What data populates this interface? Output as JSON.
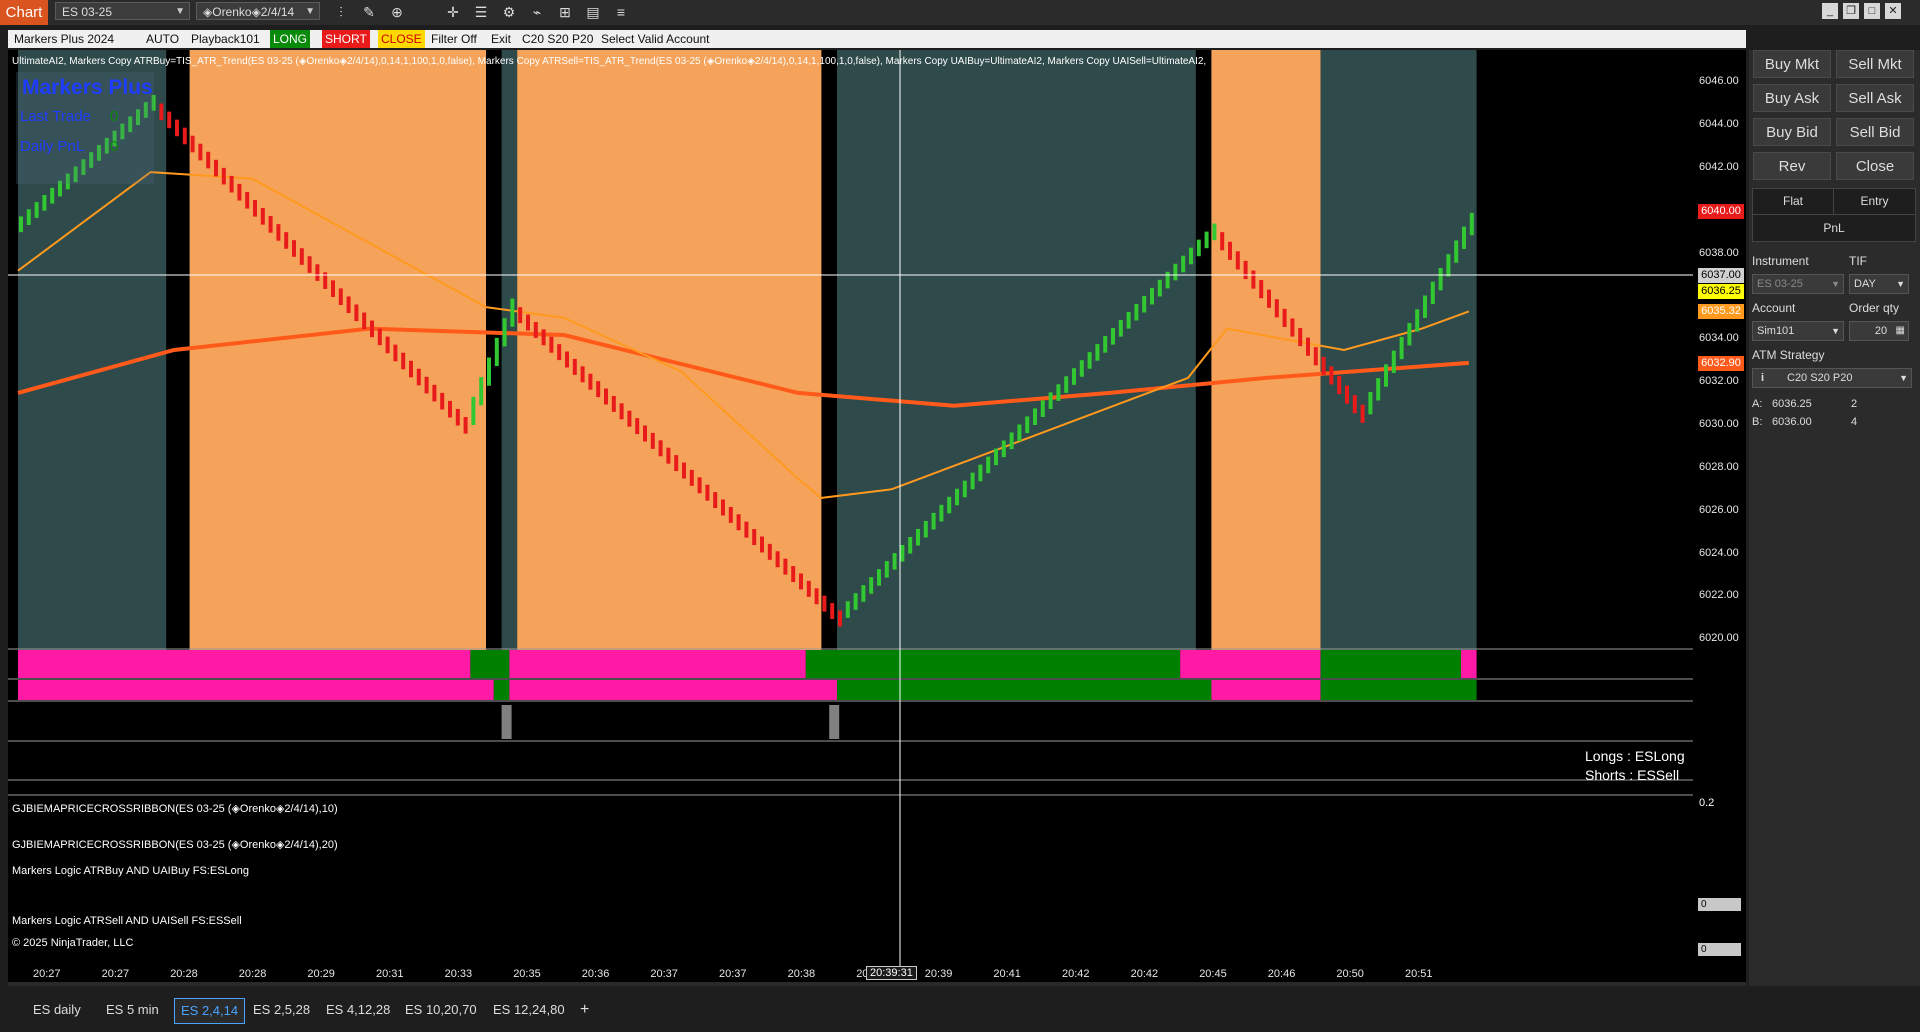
{
  "app": {
    "chart_tab": "Chart",
    "instrument_select": "ES 03-25",
    "bartype_select": "◈Orenko◈2/4/14"
  },
  "toolbar_icons": [
    "bars-icon",
    "pencil-icon",
    "zoom-in-icon",
    "crosshair-icon",
    "properties-icon",
    "strategies-icon",
    "indicators-icon",
    "chart-trader-icon",
    "data-box-icon",
    "menu-icon"
  ],
  "window_buttons": [
    "minimize-icon",
    "restore-icon",
    "maximize-icon",
    "close-icon"
  ],
  "strip": {
    "strategy": "Markers Plus 2024",
    "mode": "AUTO",
    "account": "Playback101",
    "long": "LONG",
    "short": "SHORT",
    "close": "CLOSE",
    "filter": "Filter Off",
    "exit": "Exit",
    "atm": "C20 S20 P20",
    "select": "Select Valid Account"
  },
  "chart": {
    "indicator_header": "UltimateAI2, Markers Copy ATRBuy=TIS_ATR_Trend(ES 03-25 (◈Orenko◈2/4/14),0,14,1,100,1,0,false), Markers Copy ATRSell=TIS_ATR_Trend(ES 03-25 (◈Orenko◈2/4/14),0,14,1,100,1,0,false), Markers Copy UAIBuy=UltimateAI2, Markers Copy UAISell=UltimateAI2,",
    "overlay_title": "Markers Plus",
    "last_trade_label": "Last Trade",
    "last_trade_value": "0",
    "daily_pnl_label": "Daily PnL",
    "daily_pnl_value": "0",
    "longs_text": "Longs : ESLong",
    "shorts_text": "Shorts : ESSell",
    "crosshair_price": "6037.00",
    "crosshair_time": "20:39:31",
    "price_labels": [
      {
        "text": "6040.00",
        "color": "#e81a1a"
      },
      {
        "text": "6037.00",
        "color": "#d0d0d0"
      },
      {
        "text": "6036.25",
        "color": "#ffff00"
      },
      {
        "text": "6035.32",
        "color": "#ff9a1e"
      },
      {
        "text": "6032.90",
        "color": "#ff5a1a"
      }
    ],
    "panels": {
      "ribbon1": "GJBIEMAPRICECROSSRIBBON(ES 03-25 (◈Orenko◈2/4/14),10)",
      "ribbon1_value": "0.2",
      "ribbon2": "GJBIEMAPRICECROSSRIBBON(ES 03-25 (◈Orenko◈2/4/14),20)",
      "logic_buy": "Markers Logic ATRBuy AND UAIBuy  FS:ESLong",
      "logic_buy_value": "0",
      "logic_sell": "Markers Logic ATRSell AND UAISell  FS:ESSell",
      "logic_sell_value": "0",
      "copyright": "© 2025 NinjaTrader, LLC"
    },
    "x_labels": [
      "20:27",
      "20:27",
      "20:28",
      "20:28",
      "20:29",
      "20:31",
      "20:33",
      "20:35",
      "20:36",
      "20:37",
      "20:37",
      "20:38",
      "20",
      "20:39",
      "20:41",
      "20:42",
      "20:42",
      "20:45",
      "20:46",
      "20:50",
      "20:51"
    ]
  },
  "chart_data": {
    "type": "candlestick",
    "ylim": [
      6019.5,
      6047.5
    ],
    "y_ticks": [
      "6046.00",
      "6044.00",
      "6042.00",
      "6040.00",
      "6038.00",
      "6036.00",
      "6034.00",
      "6032.00",
      "6030.00",
      "6028.00",
      "6026.00",
      "6024.00",
      "6022.00",
      "6020.00"
    ],
    "bar_count": 187,
    "segments": [
      {
        "dir": "up",
        "from": 6039.0,
        "to": 6045.0,
        "bars": 18
      },
      {
        "dir": "down",
        "from": 6045.0,
        "to": 6030.0,
        "bars": 40
      },
      {
        "dir": "up",
        "from": 6030.0,
        "to": 6035.5,
        "bars": 6
      },
      {
        "dir": "down",
        "from": 6035.5,
        "to": 6021.0,
        "bars": 42
      },
      {
        "dir": "up",
        "from": 6021.0,
        "to": 6039.0,
        "bars": 48
      },
      {
        "dir": "down",
        "from": 6039.0,
        "to": 6030.5,
        "bars": 19
      },
      {
        "dir": "up",
        "from": 6030.5,
        "to": 6039.5,
        "bars": 14
      }
    ],
    "ema_fast": [
      [
        0,
        6037.2
      ],
      [
        17,
        6041.8
      ],
      [
        30,
        6041.5
      ],
      [
        60,
        6035.5
      ],
      [
        70,
        6035.0
      ],
      [
        85,
        6032.5
      ],
      [
        100,
        6027.5
      ],
      [
        103,
        6026.6
      ],
      [
        112,
        6027.0
      ],
      [
        150,
        6032.2
      ],
      [
        155,
        6034.5
      ],
      [
        170,
        6033.5
      ],
      [
        180,
        6034.5
      ],
      [
        186,
        6035.3
      ]
    ],
    "ema_slow": [
      [
        0,
        6031.5
      ],
      [
        20,
        6033.5
      ],
      [
        45,
        6034.5
      ],
      [
        70,
        6034.2
      ],
      [
        100,
        6031.5
      ],
      [
        120,
        6030.9
      ],
      [
        140,
        6031.5
      ],
      [
        160,
        6032.2
      ],
      [
        186,
        6032.9
      ]
    ],
    "sessions": [
      {
        "color": "#2f4a4b",
        "from": 0,
        "to": 19
      },
      {
        "color": "#f5a35a",
        "from": 22,
        "to": 60
      },
      {
        "color": "#2f4a4b",
        "from": 62,
        "to": 64
      },
      {
        "color": "#f5a35a",
        "from": 64,
        "to": 103
      },
      {
        "color": "#2f4a4b",
        "from": 105,
        "to": 151
      },
      {
        "color": "#f5a35a",
        "from": 153,
        "to": 167
      },
      {
        "color": "#2f4a4b",
        "from": 167,
        "to": 187
      }
    ],
    "ribbon1": [
      {
        "color": "#ff1aa6",
        "from": 0,
        "to": 58
      },
      {
        "color": "#008000",
        "from": 58,
        "to": 63
      },
      {
        "color": "#ff1aa6",
        "from": 63,
        "to": 101
      },
      {
        "color": "#008000",
        "from": 101,
        "to": 149
      },
      {
        "color": "#ff1aa6",
        "from": 149,
        "to": 167
      },
      {
        "color": "#008000",
        "from": 167,
        "to": 185
      },
      {
        "color": "#ff1aa6",
        "from": 185,
        "to": 187
      }
    ],
    "ribbon2": [
      {
        "color": "#ff1aa6",
        "from": 0,
        "to": 61
      },
      {
        "color": "#008000",
        "from": 61,
        "to": 63
      },
      {
        "color": "#ff1aa6",
        "from": 63,
        "to": 105
      },
      {
        "color": "#008000",
        "from": 105,
        "to": 153
      },
      {
        "color": "#ff1aa6",
        "from": 153,
        "to": 167
      },
      {
        "color": "#008000",
        "from": 167,
        "to": 187
      }
    ]
  },
  "right_panel": {
    "buttons": [
      "Buy Mkt",
      "Sell Mkt",
      "Buy Ask",
      "Sell Ask",
      "Buy Bid",
      "Sell Bid",
      "Rev",
      "Close"
    ],
    "flat": "Flat",
    "entry": "Entry",
    "pnl": "PnL",
    "instrument_label": "Instrument",
    "instrument_value": "ES 03-25",
    "tif_label": "TIF",
    "tif_value": "DAY",
    "account_label": "Account",
    "account_value": "Sim101",
    "qty_label": "Order qty",
    "qty_value": "20",
    "atm_label": "ATM Strategy",
    "atm_value": "C20 S20 P20",
    "ask_label": "A:",
    "ask_price": "6036.25",
    "ask_size": "2",
    "bid_label": "B:",
    "bid_price": "6036.00",
    "bid_size": "4"
  },
  "bottom_tabs": [
    "ES daily",
    "ES 5 min",
    "ES 2,4,14",
    "ES 2,5,28",
    "ES 4,12,28",
    "ES 10,20,70",
    "ES 12,24,80"
  ],
  "active_tab": "ES 2,4,14"
}
